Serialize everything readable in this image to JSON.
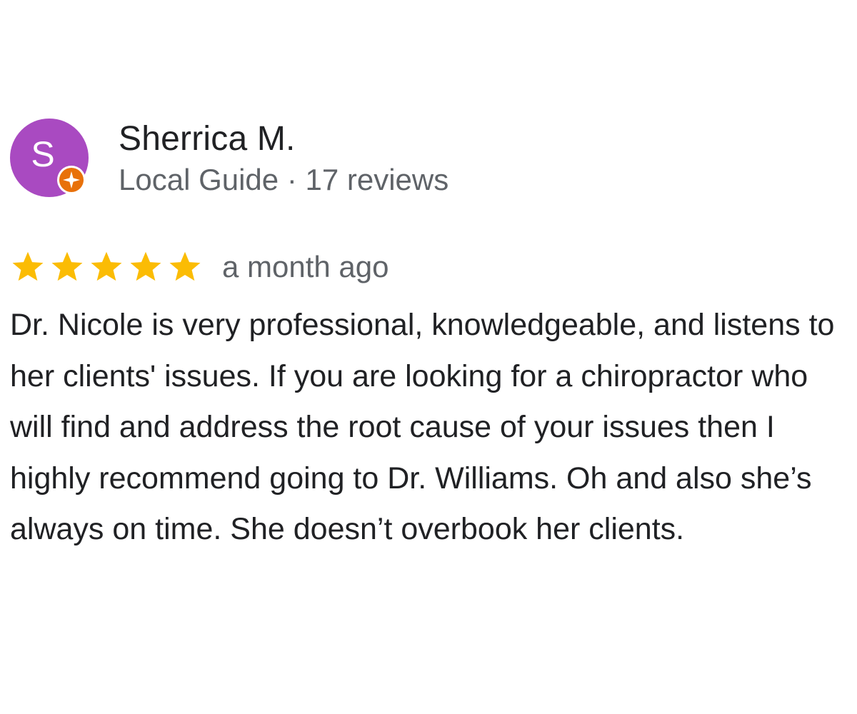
{
  "reviewer": {
    "initial": "S",
    "name": "Sherrica M.",
    "meta": "Local Guide · 17 reviews",
    "avatar_color": "#a94ac1",
    "badge_icon": "local-guide-badge-icon",
    "badge_color": "#e8710a"
  },
  "review": {
    "rating": 5,
    "max_rating": 5,
    "star_color": "#fbbc04",
    "date": "a month ago",
    "text": "Dr. Nicole is very professional, knowledgeable, and listens to her clients' issues. If you are looking for a chiropractor who will find and address the root cause of your issues then I highly recommend going to Dr. Williams. Oh and also she’s always on time. She doesn’t overbook her clients."
  }
}
